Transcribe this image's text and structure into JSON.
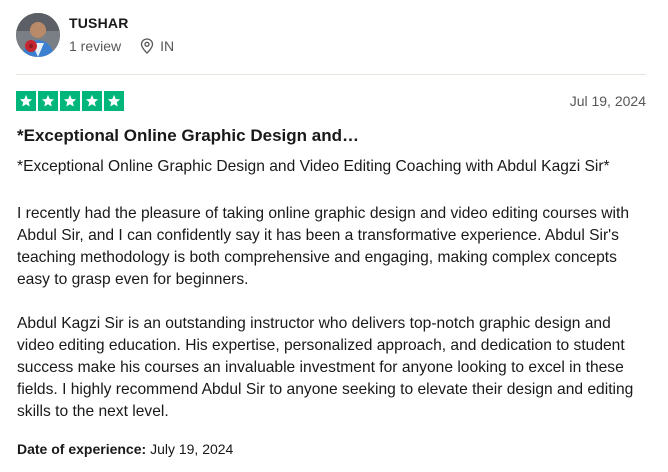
{
  "reviewer": {
    "name": "TUSHAR",
    "review_count": "1 review",
    "country": "IN"
  },
  "rating": {
    "stars": 5,
    "max_stars": 5,
    "color": "#00b67a"
  },
  "review": {
    "date": "Jul 19, 2024",
    "title": "*Exceptional Online Graphic Design and…",
    "paragraphs": [
      "*Exceptional Online Graphic Design and Video Editing Coaching with Abdul Kagzi Sir*",
      "I recently had the pleasure of taking online graphic design and video editing courses with Abdul Sir, and I can confidently say it has been a transformative experience. Abdul Sir's teaching methodology is both comprehensive and engaging, making complex concepts easy to grasp even for beginners.",
      "Abdul Kagzi Sir is an outstanding instructor who delivers top-notch graphic design and video editing education. His expertise, personalized approach, and dedication to student success make his courses an invaluable investment for anyone looking to excel in these fields. I highly recommend Abdul Sir to anyone seeking to elevate their design and editing skills to the next level."
    ],
    "experience_label": "Date of experience:",
    "experience_date": "July 19, 2024"
  }
}
